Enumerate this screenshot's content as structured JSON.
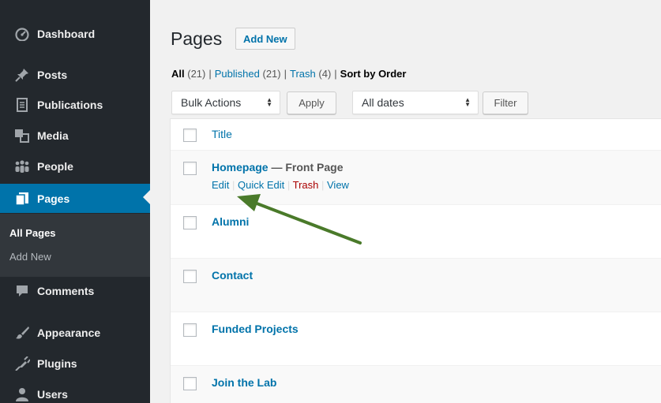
{
  "sidebar": {
    "items": [
      {
        "label": "Dashboard",
        "icon": "dashboard-icon"
      },
      {
        "label": "Posts",
        "icon": "pin-icon"
      },
      {
        "label": "Publications",
        "icon": "document-icon"
      },
      {
        "label": "Media",
        "icon": "media-icon"
      },
      {
        "label": "People",
        "icon": "people-icon"
      },
      {
        "label": "Pages",
        "icon": "pages-icon",
        "active": true
      },
      {
        "label": "Comments",
        "icon": "comment-icon"
      },
      {
        "label": "Appearance",
        "icon": "brush-icon"
      },
      {
        "label": "Plugins",
        "icon": "plug-icon"
      },
      {
        "label": "Users",
        "icon": "user-icon"
      }
    ],
    "submenu": {
      "all_pages": "All Pages",
      "add_new": "Add New"
    }
  },
  "header": {
    "title": "Pages",
    "add_new": "Add New"
  },
  "filters": {
    "all": "All",
    "all_count": "(21)",
    "published": "Published",
    "published_count": "(21)",
    "trash": "Trash",
    "trash_count": "(4)",
    "sort": "Sort by Order",
    "separator": "|"
  },
  "toolbar": {
    "bulk_actions": "Bulk Actions",
    "apply": "Apply",
    "dates": "All dates",
    "filter": "Filter"
  },
  "table": {
    "column_title": "Title",
    "rows": [
      {
        "title": "Homepage",
        "state": " — Front Page",
        "actions": [
          "Edit",
          "Quick Edit",
          "Trash",
          "View"
        ]
      },
      {
        "title": "Alumni"
      },
      {
        "title": "Contact"
      },
      {
        "title": "Funded Projects"
      },
      {
        "title": "Join the Lab"
      }
    ]
  },
  "colors": {
    "sidebar_bg": "#23282d",
    "accent": "#0073aa",
    "trash": "#a00",
    "annotation_arrow": "#4a7a2a"
  }
}
